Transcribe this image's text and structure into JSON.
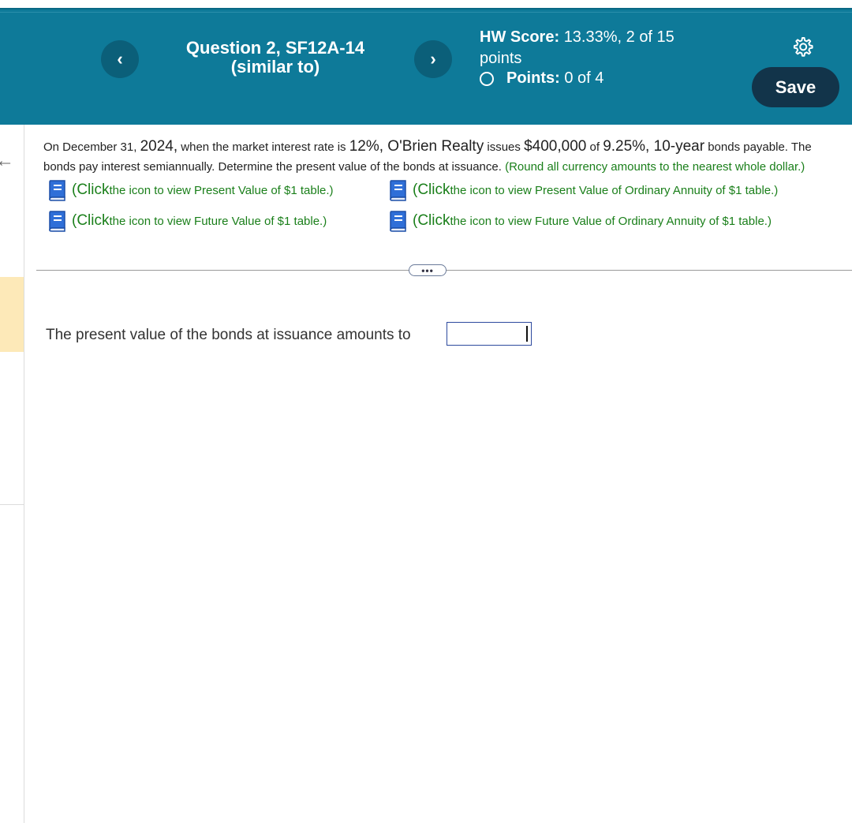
{
  "header": {
    "question_line1": "Question 2, SF12A-14",
    "question_line2": "(similar to)",
    "prev_glyph": "‹",
    "next_glyph": "›",
    "hw_score_label": "HW Score:",
    "hw_score_value": "13.33%, 2 of 15",
    "hw_score_suffix": "points",
    "points_label": "Points:",
    "points_value": "0 of 4",
    "save_label": "Save",
    "settings_icon": "gear-icon"
  },
  "problem": {
    "p1": "On December 31, ",
    "year": "2024,",
    "p2": " when the market interest rate is ",
    "rate": "12%,",
    "company": " O'Brien Realty",
    "p3": " issues ",
    "amount": "$400,000",
    "p4": " of ",
    "coupon": "9.25%,",
    "term": " 10-year",
    "p5": " bonds payable. The bonds pay interest semiannually. Determine the present value of the bonds at issuance.",
    "instruction": " (Round all currency amounts to the nearest whole dollar.)"
  },
  "links": [
    {
      "prefix": "(Click",
      "text": " the icon to view Present Value of $1 table.)"
    },
    {
      "prefix": "(Click",
      "text": " the icon to view Present Value of Ordinary Annuity of $1 table.)"
    },
    {
      "prefix": "(Click",
      "text": " the icon to view Future Value of $1 table.)"
    },
    {
      "prefix": "(Click",
      "text": " the icon to view Future Value of Ordinary Annuity of $1 table.)"
    }
  ],
  "expand_label": "•••",
  "answer": {
    "label": "The present value of the bonds at issuance amounts to",
    "value": ""
  },
  "colors": {
    "header_bg": "#0e7a99",
    "save_bg": "#12344a",
    "link_green": "#1a7f1a",
    "highlight": "#fde9b8"
  }
}
